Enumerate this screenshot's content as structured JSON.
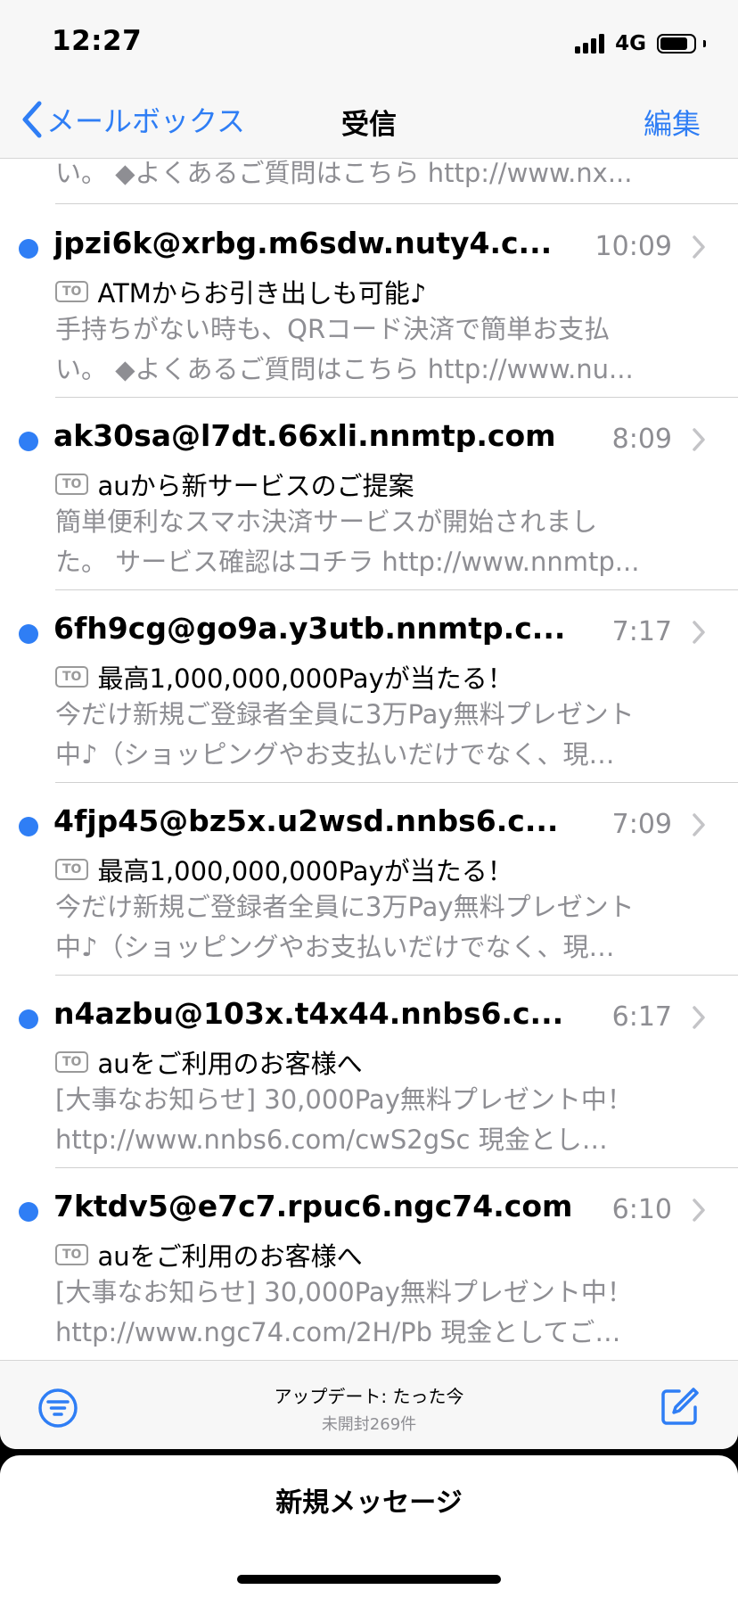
{
  "status_bar": {
    "time": "12:27",
    "network": "4G"
  },
  "nav": {
    "back_label": "メールボックス",
    "title": "受信",
    "edit_label": "編集"
  },
  "partial_row": {
    "preview_line": "い。 ◆よくあるご質問はこちら http://www.nx..."
  },
  "to_badge_label": "TO",
  "messages": [
    {
      "sender": "jpzi6k@xrbg.m6sdw.nuty4.c...",
      "time": "10:09",
      "subject": "ATMからお引き出しも可能♪",
      "preview_1": "手持ちがない時も、QRコード決済で簡単お支払",
      "preview_2": "い。 ◆よくあるご質問はこちら http://www.nu..."
    },
    {
      "sender": "ak30sa@l7dt.66xli.nnmtp.com",
      "time": "8:09",
      "subject": "auから新サービスのご提案",
      "preview_1": "簡単便利なスマホ決済サービスが開始されまし",
      "preview_2": "た。 サービス確認はコチラ http://www.nnmtp..."
    },
    {
      "sender": "6fh9cg@go9a.y3utb.nnmtp.c...",
      "time": "7:17",
      "subject": "最高1,000,000,000Payが当たる！",
      "preview_1": "今だけ新規ご登録者全員に3万Pay無料プレゼント",
      "preview_2": "中♪（ショッピングやお支払いだけでなく、現…"
    },
    {
      "sender": "4fjp45@bz5x.u2wsd.nnbs6.c...",
      "time": "7:09",
      "subject": "最高1,000,000,000Payが当たる！",
      "preview_1": "今だけ新規ご登録者全員に3万Pay無料プレゼント",
      "preview_2": "中♪（ショッピングやお支払いだけでなく、現…"
    },
    {
      "sender": "n4azbu@103x.t4x44.nnbs6.c...",
      "time": "6:17",
      "subject": "auをご利用のお客様へ",
      "preview_1": "[大事なお知らせ] 30,000Pay無料プレゼント中！",
      "preview_2": "http://www.nnbs6.com/cwS2gSc 現金とし…"
    },
    {
      "sender": "7ktdv5@e7c7.rpuc6.ngc74.com",
      "time": "6:10",
      "subject": "auをご利用のお客様へ",
      "preview_1": "[大事なお知らせ] 30,000Pay無料プレゼント中！",
      "preview_2": "http://www.ngc74.com/2H/Pb 現金としてご…"
    }
  ],
  "toolbar": {
    "update_text": "アップデート: たった今",
    "unread_text": "未開封269件"
  },
  "sheet": {
    "title": "新規メッセージ"
  },
  "colors": {
    "accent": "#2f7ef5",
    "secondary_text": "#8e8e93",
    "bar_background": "#f7f7f7"
  },
  "icons": {
    "back": "chevron-left-icon",
    "row_disclosure": "chevron-right-icon",
    "filter": "filter-circle-icon",
    "compose": "compose-icon",
    "signal": "cellular-signal-icon",
    "battery": "battery-icon"
  },
  "battery_level": 0.85
}
